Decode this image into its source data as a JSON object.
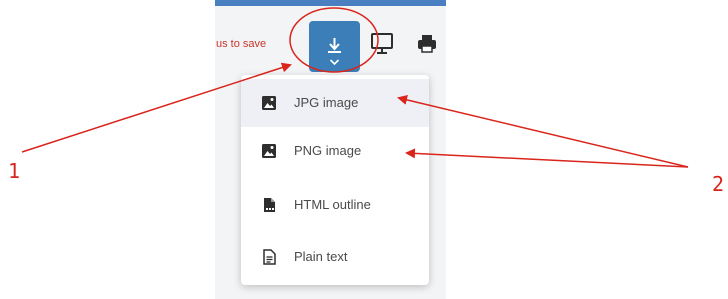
{
  "toolbar": {
    "hint_text": "us to save",
    "download_icon": "download-icon",
    "present_icon": "monitor-icon",
    "print_icon": "print-icon"
  },
  "menu": {
    "items": [
      {
        "label": "JPG image",
        "icon": "image-file-icon",
        "active": true
      },
      {
        "label": "PNG image",
        "icon": "image-file-icon",
        "active": false
      },
      {
        "label": "HTML outline",
        "icon": "document-file-icon",
        "active": false
      },
      {
        "label": "Plain text",
        "icon": "text-file-icon",
        "active": false
      }
    ]
  },
  "annotations": {
    "label_1": "1",
    "label_2": "2",
    "color": "#d9251c"
  },
  "colors": {
    "accent": "#3c7fb8",
    "hint": "#c8362b"
  }
}
